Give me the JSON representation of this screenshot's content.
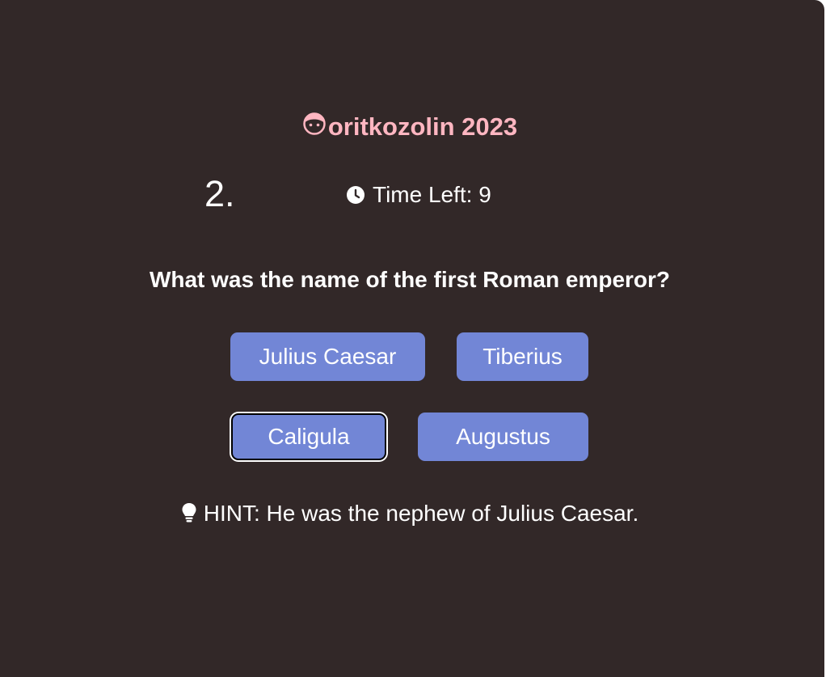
{
  "brand": {
    "text": "oritkozolin 2023",
    "icon": "face-icon",
    "color": "#ffb6c1"
  },
  "quiz": {
    "question_number": "2.",
    "timer_label": "Time Left: 9",
    "question": "What was the name of the first Roman emperor?",
    "answers": [
      {
        "label": "Julius Caesar",
        "selected": false
      },
      {
        "label": "Tiberius",
        "selected": false
      },
      {
        "label": "Caligula",
        "selected": true
      },
      {
        "label": "Augustus",
        "selected": false
      }
    ],
    "hint": "HINT: He was the nephew of Julius Caesar."
  },
  "colors": {
    "background": "#322828",
    "button": "#7286d6",
    "text": "#ffffff"
  }
}
